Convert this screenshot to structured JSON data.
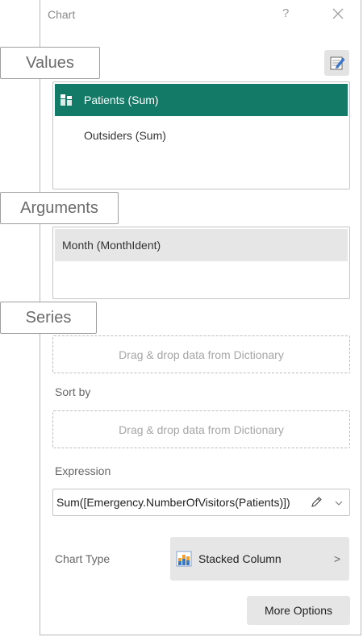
{
  "window": {
    "title": "Chart",
    "help_glyph": "?"
  },
  "callouts": {
    "values": "Values",
    "arguments": "Arguments",
    "series": "Series"
  },
  "values": {
    "items": [
      {
        "label": "Patients (Sum)",
        "selected": true,
        "icon": "stacked-column-icon"
      },
      {
        "label": "Outsiders (Sum)",
        "selected": false
      }
    ]
  },
  "arguments": {
    "items": [
      {
        "label": "Month (MonthIdent)"
      }
    ]
  },
  "series": {
    "dropzone_text": "Drag & drop data from Dictionary"
  },
  "sort_by": {
    "label": "Sort by",
    "dropzone_text": "Drag & drop data from Dictionary"
  },
  "expression": {
    "label": "Expression",
    "value": "Sum([Emergency.NumberOfVisitors(Patients)])"
  },
  "chart_type": {
    "label": "Chart Type",
    "value": "Stacked Column",
    "arrow": ">"
  },
  "buttons": {
    "more_options": "More Options"
  },
  "colors": {
    "accent": "#127a66"
  }
}
